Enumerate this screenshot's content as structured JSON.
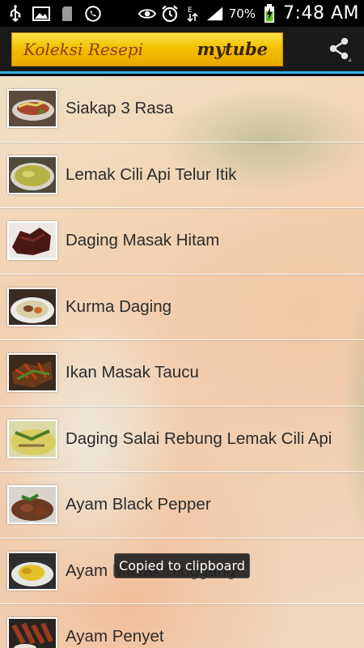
{
  "status_bar": {
    "battery_percent": "70%",
    "time": "7:48 AM",
    "left_icons": [
      "usb-icon",
      "image-icon",
      "sd-card-icon",
      "whatsapp-icon"
    ],
    "right_icons": [
      "eye-icon",
      "alarm-icon",
      "data-arrows-icon",
      "signal-icon",
      "battery-charging-icon"
    ]
  },
  "action_bar": {
    "banner_title": "Koleksi Resepi",
    "banner_brand": "mytube",
    "share_icon": "share-icon",
    "accent_color": "#33b5e5"
  },
  "recipes": [
    {
      "label": "Siakap 3 Rasa"
    },
    {
      "label": "Lemak Cili Api Telur Itik"
    },
    {
      "label": "Daging Masak Hitam"
    },
    {
      "label": "Kurma Daging"
    },
    {
      "label": "Ikan Masak Taucu"
    },
    {
      "label": "Daging Salai Rebung Lemak Cili Api"
    },
    {
      "label": "Ayam Black Pepper"
    },
    {
      "label": "Ayam Masak Singgang"
    },
    {
      "label": "Ayam Penyet"
    }
  ],
  "toast": {
    "text": "Copied to clipboard"
  }
}
